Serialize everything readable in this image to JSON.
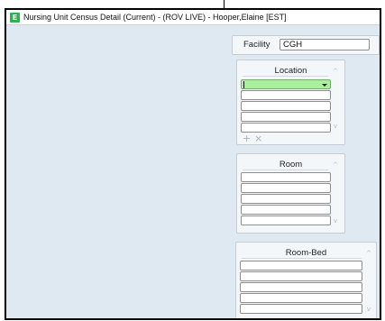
{
  "window": {
    "icon_letter": "E",
    "title": "Nursing Unit Census Detail (Current) - (ROV LIVE) - Hooper,Elaine [EST]"
  },
  "facility": {
    "label": "Facility",
    "value": "CGH"
  },
  "location": {
    "title": "Location",
    "add_icon": "+",
    "remove_icon": "×"
  },
  "room": {
    "title": "Room"
  },
  "room_bed": {
    "title": "Room-Bed"
  },
  "icons": {
    "scroll_up": "^",
    "scroll_down": "v"
  },
  "colors": {
    "background": "#dfe9f1",
    "active_field": "#a8f09c",
    "app_icon": "#2fb34a"
  }
}
